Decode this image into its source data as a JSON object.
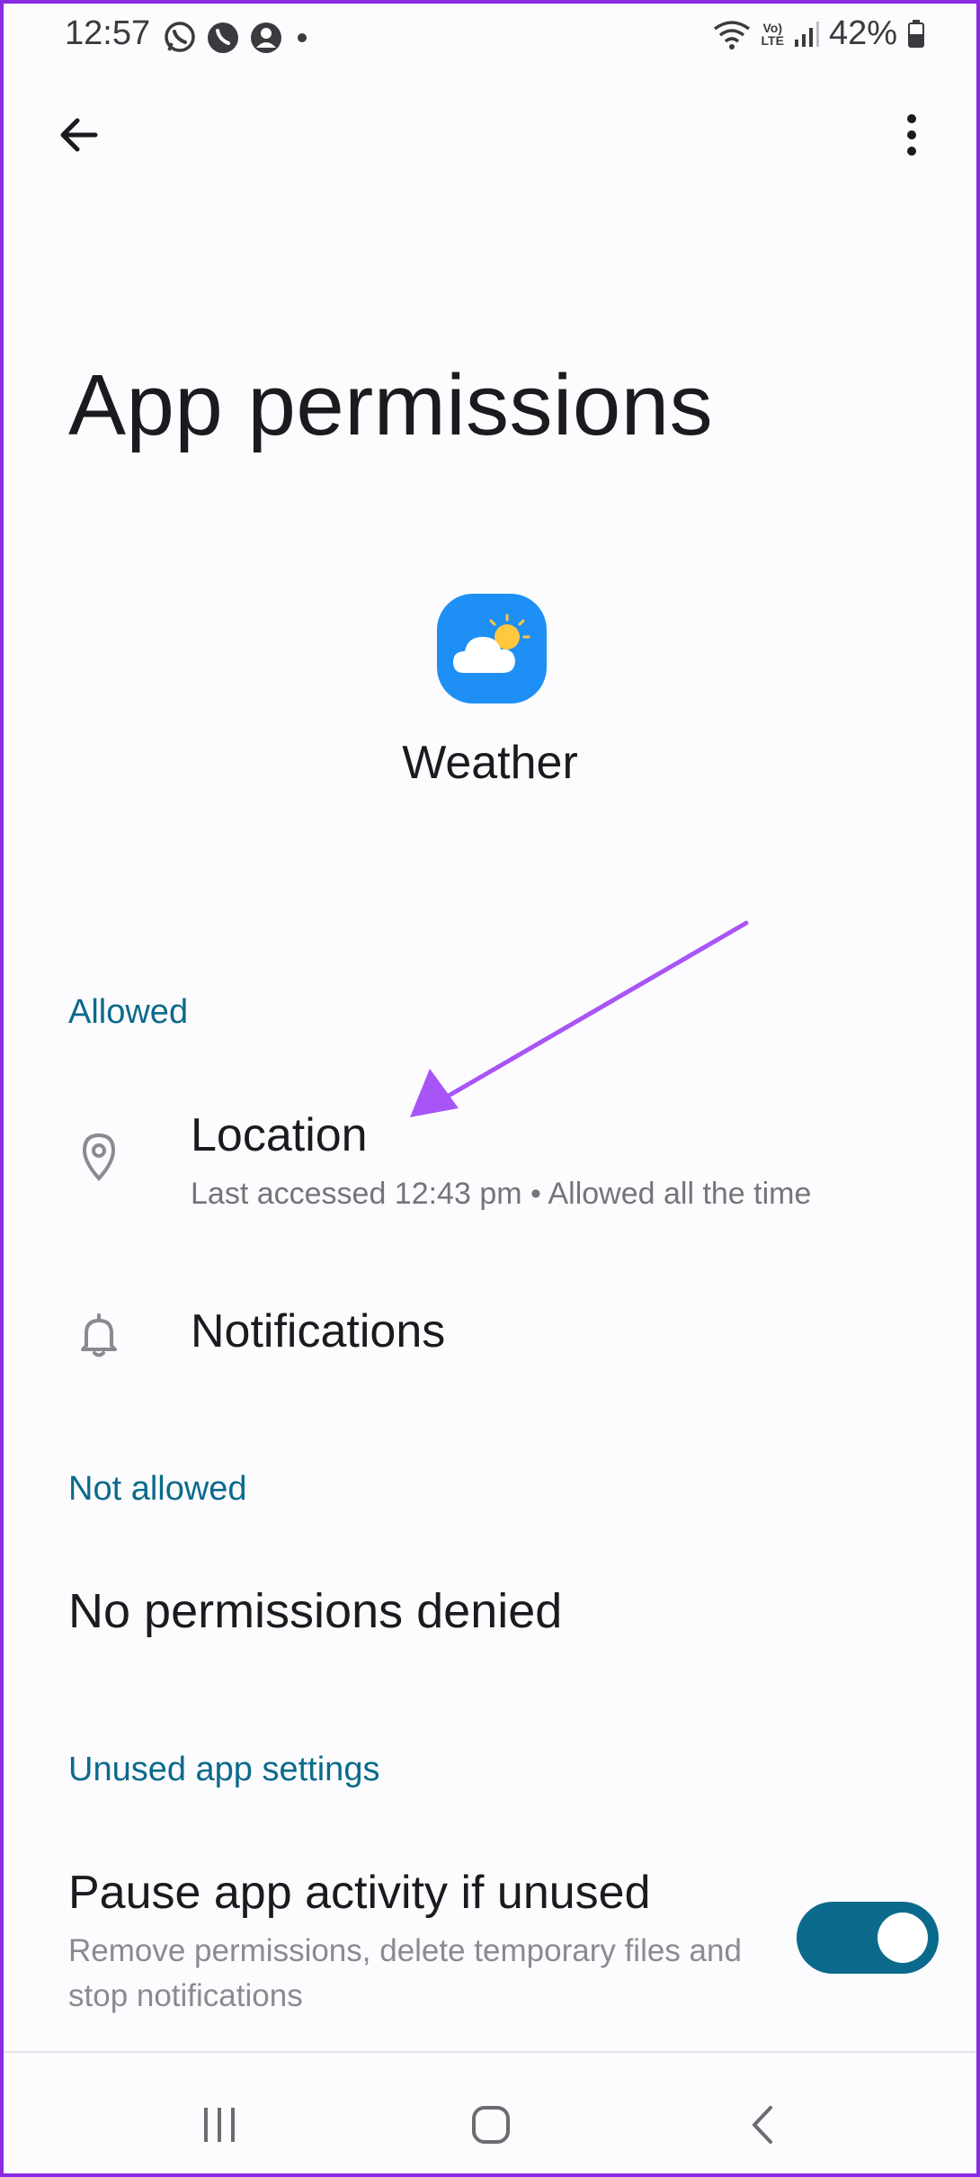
{
  "status_bar": {
    "time": "12:57",
    "left_icons": [
      "whatsapp-icon",
      "viber-icon",
      "account-icon",
      "dot-icon"
    ],
    "right_icons": [
      "wifi-icon",
      "volte-icon",
      "signal-icon",
      "battery-icon"
    ],
    "volte_top": "Vo)",
    "volte_bottom": "LTE",
    "battery": "42%"
  },
  "app_bar": {
    "back_icon": "arrow-back-icon",
    "menu_icon": "more-vert-icon"
  },
  "page": {
    "title": "App permissions",
    "app_name": "Weather",
    "app_icon": "weather-cloud-sun-icon"
  },
  "sections": {
    "allowed": {
      "header": "Allowed",
      "items": [
        {
          "title": "Location",
          "subtitle": "Last accessed 12:43 pm • Allowed all the time",
          "icon": "location-pin-icon"
        },
        {
          "title": "Notifications",
          "subtitle": "",
          "icon": "bell-icon"
        }
      ]
    },
    "not_allowed": {
      "header": "Not allowed",
      "empty_text": "No permissions denied"
    },
    "unused": {
      "header": "Unused app settings",
      "pause_title": "Pause app activity if unused",
      "pause_desc": "Remove permissions, delete temporary files and stop notifications",
      "toggle_on": true
    }
  },
  "nav_bar": {
    "recents_icon": "recents-icon",
    "home_icon": "home-icon",
    "back_icon": "nav-back-icon"
  },
  "colors": {
    "accent": "#0b6a8c",
    "annotation": "#a855f7",
    "icon_blue": "#1e90ff"
  }
}
